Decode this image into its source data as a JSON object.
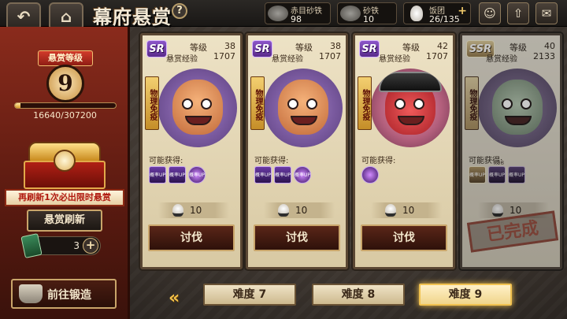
{
  "header": {
    "back_icon": "back-arrow-icon",
    "home_icon": "house-icon",
    "title": "幕府悬赏",
    "help": "?"
  },
  "resources": [
    {
      "name": "赤目砂铁",
      "value": "98",
      "icon": "iron-sand-icon"
    },
    {
      "name": "砂铁",
      "value": "10",
      "icon": "iron-sand-icon"
    },
    {
      "name": "饭团",
      "value": "26/135",
      "icon": "rice-ball-icon",
      "plus": "+"
    }
  ],
  "top_icons": [
    "character-icon",
    "upgrade-arrow-icon",
    "mail-icon"
  ],
  "rank": {
    "ribbon": "悬赏等级",
    "level": "9",
    "xp_text": "16640/307200",
    "xp_fraction": 0.054
  },
  "refresh": {
    "banner": "再刷新1次必出限时悬赏",
    "button": "悬赏刷新",
    "ticket_count": "3",
    "plus": "+"
  },
  "forge": {
    "label": "前往锻造"
  },
  "cards": [
    {
      "rarity": "SR",
      "level_label": "等级",
      "level": "38",
      "exp_label": "悬赏经验",
      "exp": "1707",
      "immune": "物理免疫",
      "drops_label": "可能获得:",
      "drops": [
        "概率UP!",
        "概率UP!",
        "概率UP!"
      ],
      "rice": "10",
      "action": "讨伐",
      "done": false
    },
    {
      "rarity": "SR",
      "level_label": "等级",
      "level": "38",
      "exp_label": "悬赏经验",
      "exp": "1707",
      "immune": "物理免疫",
      "drops_label": "可能获得:",
      "drops": [
        "概率UP!",
        "概率UP!",
        "概率UP!"
      ],
      "rice": "10",
      "action": "讨伐",
      "done": false
    },
    {
      "rarity": "SR",
      "level_label": "等级",
      "level": "42",
      "exp_label": "悬赏经验",
      "exp": "1707",
      "immune": "物理免疫",
      "drops_label": "可能获得:",
      "drops": [
        ""
      ],
      "rice": "10",
      "action": "讨伐",
      "done": false
    },
    {
      "rarity": "SSR",
      "level_label": "等级",
      "level": "40",
      "exp_label": "悬赏经验",
      "exp": "2133",
      "immune": "物理免疫",
      "drops_label": "可能获得:",
      "drops": [
        "概率UP!",
        "概率UP!",
        "概率UP!"
      ],
      "drop_count": "x98",
      "rice": "10",
      "done_label": "已完成",
      "done": true
    }
  ],
  "difficulty": {
    "prev_arrow": "«",
    "tabs": [
      "难度 7",
      "难度 8",
      "难度 9"
    ],
    "selected": "难度 9"
  }
}
